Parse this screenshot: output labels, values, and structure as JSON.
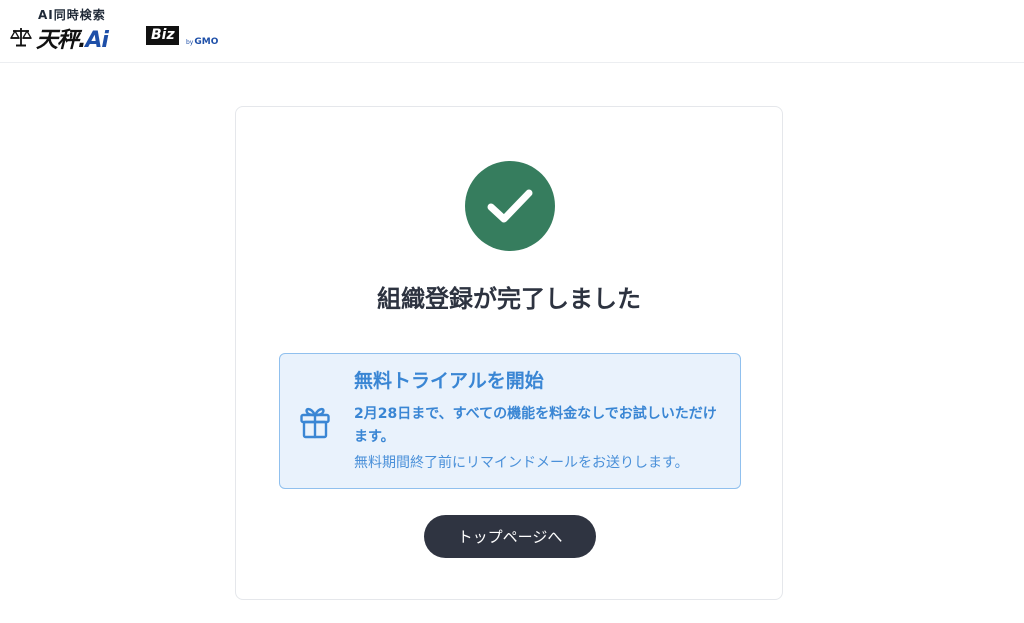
{
  "header": {
    "logo": {
      "tagline": "AI同時検索",
      "wordmark_main": "天秤.",
      "wordmark_ai": "Ai",
      "badge": "Biz",
      "by": "by",
      "company": "GMO"
    }
  },
  "card": {
    "title": "組織登録が完了しました",
    "trial": {
      "heading": "無料トライアルを開始",
      "body": "2月28日まで、すべての機能を料金なしでお試しいただけます。",
      "note": "無料期間終了前にリマインドメールをお送りします。"
    },
    "button_label": "トップページへ"
  },
  "colors": {
    "success": "#367d5e",
    "trial_accent": "#3a86d4",
    "trial_bg": "#e9f2fc",
    "button_bg": "#2f3441"
  },
  "icons": {
    "success": "check-icon",
    "trial": "gift-icon",
    "logo": "balance-scale-icon"
  }
}
